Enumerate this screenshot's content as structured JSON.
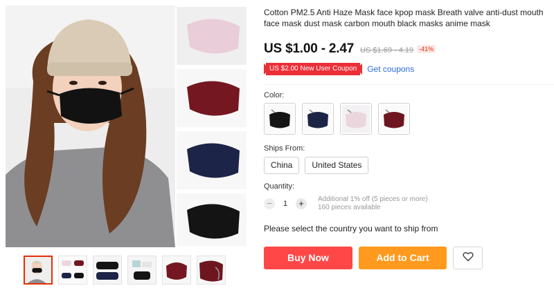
{
  "product": {
    "title": "Cotton PM2.5 Anti Haze Mask face kpop mask Breath valve anti-dust mouth face mask dust mask carbon mouth black masks anime mask",
    "price": "US $1.00 - 2.47",
    "original_price": "US $1.69 - 4.19",
    "discount": "-41%",
    "coupon": "US $2.00 New User Coupon",
    "get_coupons": "Get coupons"
  },
  "options": {
    "color_label": "Color:",
    "colors": [
      {
        "name": "black",
        "hex": "#151515"
      },
      {
        "name": "navy",
        "hex": "#1c2546"
      },
      {
        "name": "pink",
        "hex": "#ecd6de"
      },
      {
        "name": "wine-red",
        "hex": "#6e1620"
      }
    ],
    "ships_from_label": "Ships From:",
    "ships_from": [
      "China",
      "United States"
    ],
    "quantity_label": "Quantity:",
    "quantity": "1",
    "minus": "−",
    "plus": "+",
    "bulk_note": "Additional 1% off (5 pieces or more)",
    "available": "160 pieces available"
  },
  "shipping_message": "Please select the country you want to ship from",
  "actions": {
    "buy_now": "Buy Now",
    "add_to_cart": "Add to Cart"
  },
  "gallery": {
    "thumbnails": [
      "model-wearing-mask",
      "mask-variants-set",
      "black-and-navy-masks",
      "mask-with-filters",
      "wine-red-mask",
      "wine-red-mask-closeup"
    ],
    "active_index": 0
  },
  "colors": {
    "price_accent": "#ff4747",
    "cart_accent": "#ff9a1e",
    "link": "#2b6bd6",
    "coupon_bg": "#ea2f37"
  }
}
